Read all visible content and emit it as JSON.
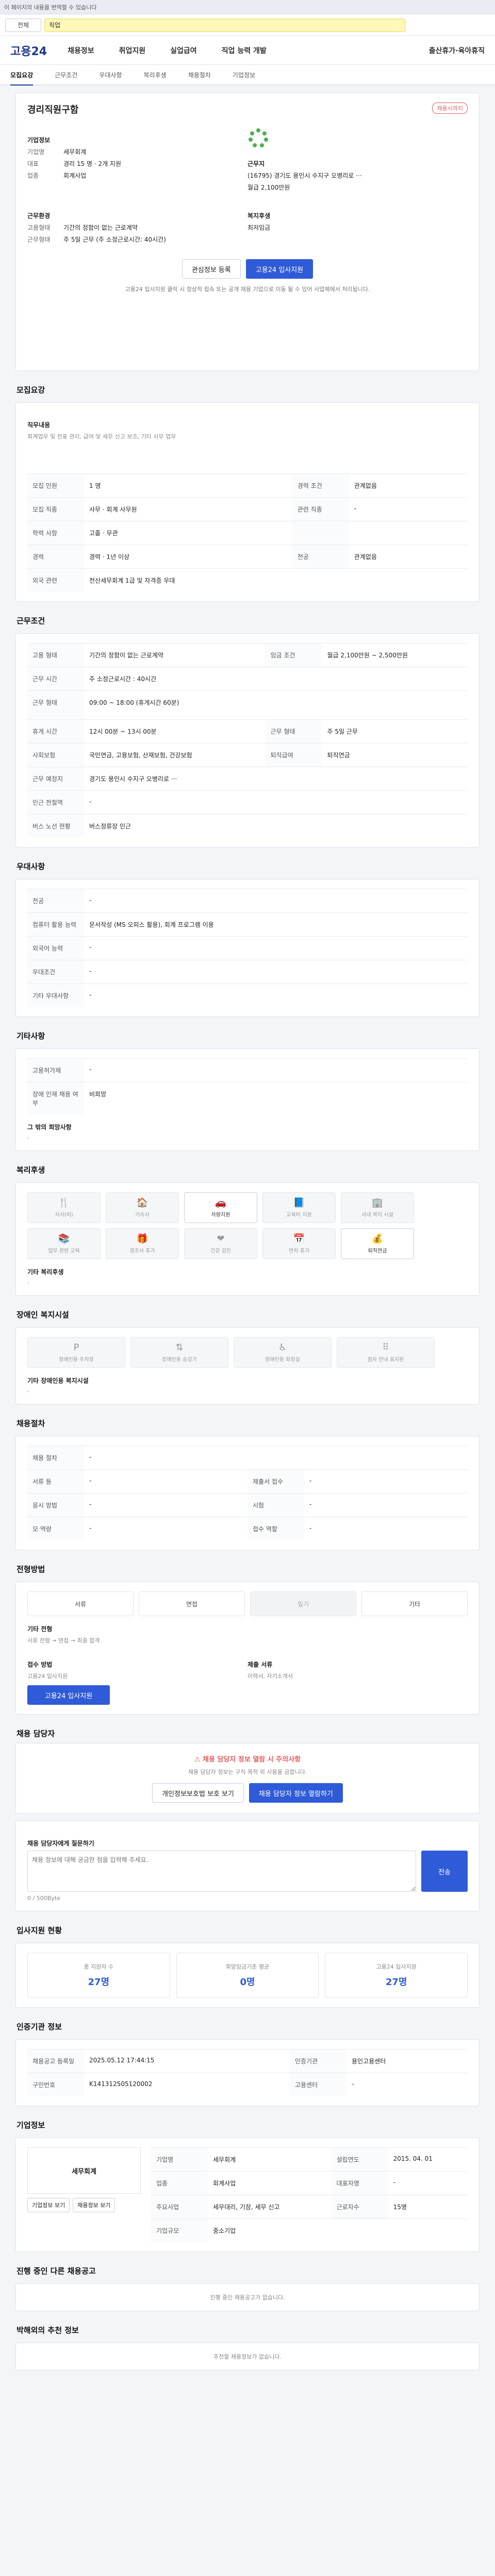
{
  "topbar": {
    "text": "이 페이지의 내용을 번역할 수 있습니다"
  },
  "search": {
    "scope": "전체",
    "value": "직업"
  },
  "gnb": {
    "logo": "고용24",
    "menus": [
      "채용정보",
      "취업지원",
      "실업급여",
      "직업 능력 개발",
      "출산휴가·육아휴직"
    ]
  },
  "tabs": [
    "모집요강",
    "근무조건",
    "우대사항",
    "복리후생",
    "채용절차",
    "기업정보"
  ],
  "header": {
    "title": "경리직원구함",
    "label": "채용시까지",
    "company_h": "기업정보",
    "company": [
      {
        "k": "기업명",
        "v": "세무회계"
      },
      {
        "k": "대표",
        "v": "경리 15 명 · 2개 지원"
      },
      {
        "k": "업종",
        "v": "회계사업"
      }
    ],
    "addr_h": "근무지",
    "addr": "(16795) 경기도 용인시 수지구 오병리로 ···",
    "condition_h": "근무환경",
    "condition": [
      {
        "k": "고용형태",
        "v": "기간의 정함이 없는 근로계약"
      },
      {
        "k": "근무형태",
        "v": "주 5일 근무 (주 소정근로시간: 40시간)"
      }
    ],
    "pay_h": "복지후생",
    "pay": "최저임금",
    "deadline": "월급 2,100만원",
    "btn_interest": "관심정보 등록",
    "btn_apply": "고용24 입사지원",
    "note": "고용24 입사지원 클릭 시 정상적 접속 또는 공개 채용 기업으로 이동 될 수 있어 사업체에서 처리됩니다."
  },
  "recruit": {
    "title": "모집요강",
    "duty_h": "직무내용",
    "duty": "회계업무 및 전표 관리, 급여 및 세무 신고 보조, 기타 사무 업무",
    "rows": [
      {
        "k": "모집 인원",
        "v": "1 명",
        "k2": "경력 조건",
        "v2": "관계없음"
      },
      {
        "k": "모집 직종",
        "v": "사무 · 회계 사무원",
        "k2": "관련 직종",
        "v2": "-"
      },
      {
        "k": "학력 사항",
        "v": "고졸 · 무관",
        "k2": "",
        "v2": ""
      },
      {
        "k": "경력",
        "v": "경력 · 1년 이상",
        "k2": "전공",
        "v2": "관계없음"
      },
      {
        "k": "외국 관련",
        "v": "전산세무회계 1급 및 자격증 우대",
        "k2": "",
        "v2": ""
      }
    ]
  },
  "work": {
    "title": "근무조건",
    "rows": [
      {
        "k": "고용 형태",
        "v": "기간의 정함이 없는 근로계약",
        "k2": "임금 조건",
        "v2": "월급 2,100만원 ~ 2,500만원"
      },
      {
        "k": "근무 시간",
        "v": "주 소정근로시간 : 40시간",
        "k2": "",
        "v2": ""
      },
      {
        "k": "근무 형태",
        "v": "09:00 ~ 18:00 (휴게시간 60분)",
        "k2": "",
        "v2": ""
      },
      {
        "k": "휴게 시간",
        "v": "12시 00분 ~ 13시 00분",
        "k2": "근무 형태",
        "v2": "주 5일 근무"
      },
      {
        "k": "사회보험",
        "v": "국민연금, 고용보험, 산재보험, 건강보험",
        "k2": "퇴직급여",
        "v2": "퇴직연금"
      },
      {
        "k": "근무 예정지",
        "v": "경기도 용인시 수지구 오병리로 ···",
        "k2": "",
        "v2": ""
      },
      {
        "k": "인근 전철역",
        "v": "-",
        "k2": "",
        "v2": ""
      },
      {
        "k": "버스 노선 현황",
        "v": "버스정류장 인근",
        "k2": "",
        "v2": ""
      }
    ]
  },
  "prefer": {
    "title": "우대사항",
    "rows": [
      {
        "k": "전공",
        "v": "-"
      },
      {
        "k": "컴퓨터 활용 능력",
        "v": "문서작성 (MS 오피스 활용), 회계 프로그램 이용"
      },
      {
        "k": "외국어 능력",
        "v": "-"
      },
      {
        "k": "우대조건",
        "v": "-"
      },
      {
        "k": "기타 우대사항",
        "v": "-"
      }
    ]
  },
  "etc": {
    "title": "기타사항",
    "rows": [
      {
        "k": "고용허가제",
        "v": "-"
      },
      {
        "k": "장애 인재 채용 여부",
        "v": "비희망"
      }
    ],
    "extra_h": "그 밖의 희망사항",
    "extra": "-"
  },
  "welfare": {
    "title": "복리후생",
    "items": [
      {
        "name": "식사(비)",
        "on": false
      },
      {
        "name": "기숙사",
        "on": false
      },
      {
        "name": "차량지원",
        "on": true
      },
      {
        "name": "교육비 지원",
        "on": false
      },
      {
        "name": "사내 복지 시설",
        "on": false
      },
      {
        "name": "업무 관련 교육",
        "on": false
      },
      {
        "name": "경조사 휴가",
        "on": false
      },
      {
        "name": "건강 검진",
        "on": false
      },
      {
        "name": "연차 휴가",
        "on": false
      },
      {
        "name": "퇴직연금",
        "on": true
      }
    ],
    "extra_h": "기타 복리후생",
    "extra": "-"
  },
  "disabled": {
    "title": "장애인 복지시설",
    "items": [
      "장애인용 주차장",
      "장애인용 승강기",
      "장애인용 화장실",
      "점자 안내 표지판"
    ],
    "extra_h": "기타 장애인용 복지시설",
    "extra": "-"
  },
  "process": {
    "title": "채용절차",
    "rows": [
      {
        "k": "채용 절차",
        "v": "-"
      },
      {
        "k": "서류 등",
        "v": "-",
        "k2": "제출서 접수",
        "v2": "-"
      },
      {
        "k": "응시 방법",
        "v": "-",
        "k2": "시험",
        "v2": "-"
      },
      {
        "k": "모 역량",
        "v": "-",
        "k2": "접수 역할",
        "v2": "-"
      }
    ]
  },
  "apply": {
    "title": "전형방법",
    "pills": [
      {
        "name": "서류",
        "off": false
      },
      {
        "name": "면접",
        "off": false
      },
      {
        "name": "필기",
        "off": true
      },
      {
        "name": "기타",
        "off": false
      }
    ],
    "etc_h": "기타 전형",
    "etc": "서류 전형 → 면접 → 최종 합격",
    "how_h": "접수 방법",
    "how": "고용24 입사지원",
    "doc_h": "제출 서류",
    "doc": "이력서, 자기소개서",
    "btn": "고용24 입사지원"
  },
  "manager": {
    "title": "채용 담당자",
    "alert": "채용 담당자 정보 열람 시 주의사항",
    "alert_sub": "채용 담당자 정보는 구직 목적 외 사용을 금합니다.",
    "btn1": "개인정보보호법 보호 보기",
    "btn2": "채용 담당자 정보 열람하기"
  },
  "inquiry": {
    "title": "채용 담당자에게 질문하기",
    "placeholder": "채용 정보에 대해 궁금한 점을 입력해 주세요.",
    "count": "0 / 500Byte",
    "btn": "전송"
  },
  "stats": {
    "title": "입사지원 현황",
    "items": [
      {
        "k": "총 지원자 수",
        "v": "27명"
      },
      {
        "k": "희망임금기준 평균",
        "v": "0명"
      },
      {
        "k": "고용24 입사지원",
        "v": "27명"
      }
    ]
  },
  "auth": {
    "title": "인증기관 정보",
    "rows": [
      {
        "k": "채용공고 등록일",
        "v": "2025.05.12 17:44:15",
        "k2": "인증기관",
        "v2": "용인고용센터"
      },
      {
        "k": "구인번호",
        "v": "K141312505120002",
        "k2": "고용센터",
        "v2": "-"
      }
    ]
  },
  "company": {
    "title": "기업정보",
    "name": "세무회계",
    "rows": [
      {
        "k": "기업명",
        "v": "세무회계",
        "k2": "설립연도",
        "v2": "2015. 04. 01"
      },
      {
        "k": "업종",
        "v": "회계사업",
        "k2": "대표자명",
        "v2": "-"
      },
      {
        "k": "주요사업",
        "v": "세무대리, 기장, 세무 신고",
        "k2": "근로자수",
        "v2": "15명"
      },
      {
        "k": "기업규모",
        "v": "중소기업",
        "k2": "",
        "v2": ""
      }
    ],
    "btn1": "기업정보 보기",
    "btn2": "채용정보 보기"
  },
  "other_jobs": {
    "title": "진행 중인 다른 채용공고",
    "empty": "진행 중인 채용공고가 없습니다."
  },
  "recommend": {
    "title": "박해외의 추천 정보",
    "empty": "추천할 채용정보가 없습니다."
  },
  "colors": {
    "primary": "#2f5bd8",
    "brand": "#1e3a8a",
    "accent_red": "#e35d5d"
  }
}
